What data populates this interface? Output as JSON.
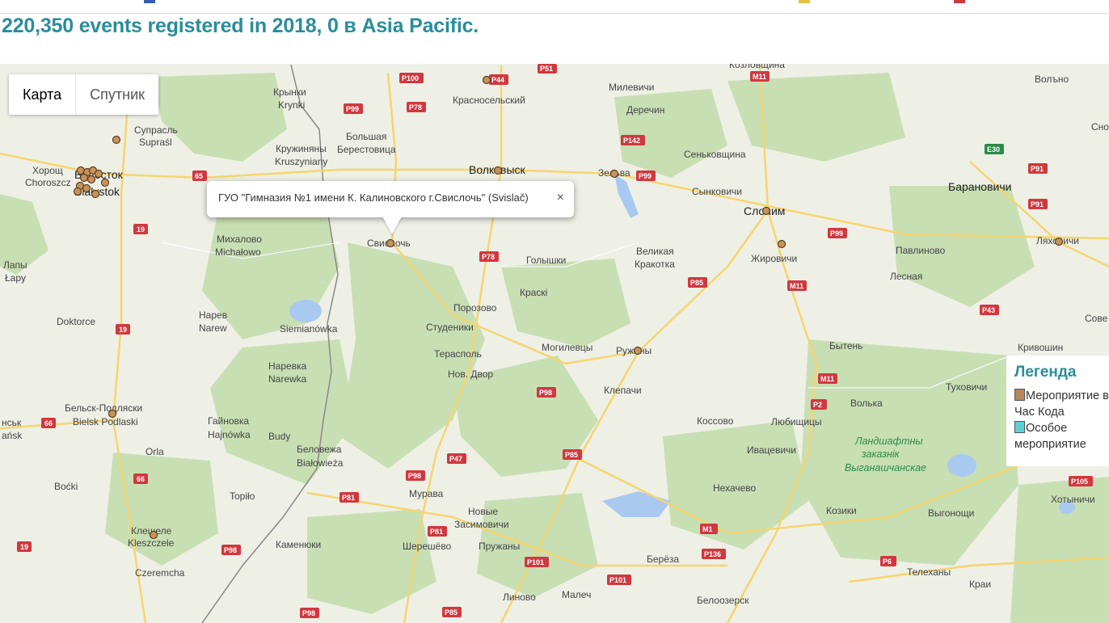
{
  "headline": "220,350 events registered in 2018, 0 в Asia Pacific.",
  "map_type": {
    "map_label": "Карта",
    "satellite_label": "Спутник"
  },
  "info_window": {
    "text": "ГУО \"Гимназия №1 имени К. Калиновского г.Свислочь\" (Svislač)",
    "close": "×"
  },
  "legend": {
    "title": "Легенда",
    "item1_line1": "Мероприятие в",
    "item1_line2": "Час Кода",
    "item2_line1": "Особое",
    "item2_line2": "мероприятие"
  },
  "colors": {
    "headline": "#2a8d9a",
    "marker": "#c8935a",
    "swatch_hour_of_code": "#b7875e",
    "swatch_special": "#5fd0d6",
    "road_shield": "#d0383f",
    "forest": "#c8dfb4",
    "land": "#eef0e6",
    "water": "#a9c9f0"
  },
  "places": [
    {
      "name": "Козловщина"
    },
    {
      "name": "Волъно"
    },
    {
      "name": "Крынки"
    },
    {
      "name": "Krynki"
    },
    {
      "name": "Милевичи"
    },
    {
      "name": "Красносельский"
    },
    {
      "name": "Деречин"
    },
    {
      "name": "Супрасль"
    },
    {
      "name": "Supraśl"
    },
    {
      "name": "Большая"
    },
    {
      "name": "Берестовица"
    },
    {
      "name": "Кружиняны"
    },
    {
      "name": "Kruszyniany"
    },
    {
      "name": "Сеньковщина"
    },
    {
      "name": "Хорощ"
    },
    {
      "name": "Choroszcz"
    },
    {
      "name": "Белосток"
    },
    {
      "name": "Białystok"
    },
    {
      "name": "Волковыск"
    },
    {
      "name": "Зельва"
    },
    {
      "name": "Сынковичи"
    },
    {
      "name": "Слоним"
    },
    {
      "name": "Барановичи"
    },
    {
      "name": "Свислочь"
    },
    {
      "name": "Михалово"
    },
    {
      "name": "Michałowo"
    },
    {
      "name": "Голышки"
    },
    {
      "name": "Великая"
    },
    {
      "name": "Кракотка"
    },
    {
      "name": "Жировичи"
    },
    {
      "name": "Павлиново"
    },
    {
      "name": "Ляховичи"
    },
    {
      "name": "Лапы"
    },
    {
      "name": "Łapy"
    },
    {
      "name": "Краскі"
    },
    {
      "name": "Лесная"
    },
    {
      "name": "Порозово"
    },
    {
      "name": "Нарев"
    },
    {
      "name": "Narew"
    },
    {
      "name": "Doktorce"
    },
    {
      "name": "Siemianówka"
    },
    {
      "name": "Студеники"
    },
    {
      "name": "Могилевцы"
    },
    {
      "name": "Ружаны"
    },
    {
      "name": "Бытень"
    },
    {
      "name": "Кривошин"
    },
    {
      "name": "Терасполь"
    },
    {
      "name": "Нов. Двор"
    },
    {
      "name": "Наревка"
    },
    {
      "name": "Narewka"
    },
    {
      "name": "Туховичи"
    },
    {
      "name": "Клепачи"
    },
    {
      "name": "Волька"
    },
    {
      "name": "Бельск-Подляски"
    },
    {
      "name": "Bielsk Podlaski"
    },
    {
      "name": "Гайновка"
    },
    {
      "name": "Hajnówka"
    },
    {
      "name": "Budy"
    },
    {
      "name": "Коссово"
    },
    {
      "name": "Любищицы"
    },
    {
      "name": "Ландшафтны"
    },
    {
      "name": "заказнік"
    },
    {
      "name": "Выганашчанскае"
    },
    {
      "name": "Беловежа"
    },
    {
      "name": "Białowieża"
    },
    {
      "name": "Orla"
    },
    {
      "name": "Ивацевичи"
    },
    {
      "name": "Boćki"
    },
    {
      "name": "Мурава"
    },
    {
      "name": "Нехачево"
    },
    {
      "name": "Topiło"
    },
    {
      "name": "Новые"
    },
    {
      "name": "Засимовичи"
    },
    {
      "name": "Козики"
    },
    {
      "name": "Выгонощи"
    },
    {
      "name": "Хотыничи"
    },
    {
      "name": "Клещеле"
    },
    {
      "name": "Kleszczele"
    },
    {
      "name": "Каменюки"
    },
    {
      "name": "Шерешёво"
    },
    {
      "name": "Пружаны"
    },
    {
      "name": "Берёза"
    },
    {
      "name": "Czeremcha"
    },
    {
      "name": "Телеханы"
    },
    {
      "name": "Краи"
    },
    {
      "name": "Линово"
    },
    {
      "name": "Малеч"
    },
    {
      "name": "Белоозерск"
    },
    {
      "name": "Сно"
    },
    {
      "name": "Сове"
    },
    {
      "name": "нськ"
    },
    {
      "name": "ańsk"
    }
  ],
  "roads": [
    "P100",
    "P44",
    "P51",
    "M11",
    "P99",
    "P78",
    "P142",
    "P99",
    "E30",
    "P91",
    "65",
    "P91",
    "19",
    "P99",
    "P78",
    "M11",
    "P85",
    "P43",
    "19",
    "M11",
    "P98",
    "P2",
    "66",
    "P85",
    "P47",
    "P98",
    "66",
    "P81",
    "P105",
    "P81",
    "M1",
    "19",
    "P98",
    "P101",
    "P136",
    "P6",
    "P101",
    "P98",
    "P85"
  ]
}
